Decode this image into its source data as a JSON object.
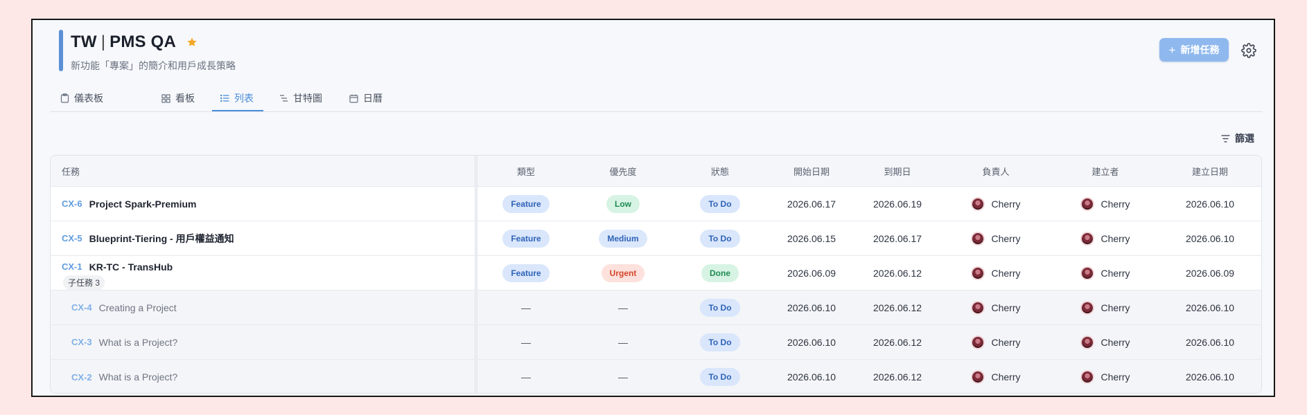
{
  "header": {
    "title_left": "TW",
    "title_sep": "|",
    "title_right": "PMS QA",
    "subtitle": "新功能「專案」的簡介和用戶成長策略",
    "new_task_label": "新增任務",
    "accent_color": "#5b8fd6",
    "star_color": "#f5a623"
  },
  "tabs": [
    {
      "label": "儀表板",
      "icon": "clipboard-icon"
    },
    {
      "label": "看板",
      "icon": "grid-icon"
    },
    {
      "label": "列表",
      "icon": "list-icon",
      "active": true
    },
    {
      "label": "甘特圖",
      "icon": "gantt-icon"
    },
    {
      "label": "日曆",
      "icon": "calendar-icon"
    }
  ],
  "filter_label": "篩選",
  "table": {
    "columns": [
      "任務",
      "類型",
      "優先度",
      "狀態",
      "開始日期",
      "到期日",
      "負責人",
      "建立者",
      "建立日期"
    ],
    "rows": [
      {
        "id": "CX-6",
        "name": "Project Spark-Premium",
        "type": "Feature",
        "priority": "Low",
        "status": "To Do",
        "start": "2026.06.17",
        "due": "2026.06.19",
        "assignee": "Cherry",
        "creator": "Cherry",
        "created": "2026.06.10"
      },
      {
        "id": "CX-5",
        "name": "Blueprint-Tiering - 用戶權益通知",
        "type": "Feature",
        "priority": "Medium",
        "status": "To Do",
        "start": "2026.06.15",
        "due": "2026.06.17",
        "assignee": "Cherry",
        "creator": "Cherry",
        "created": "2026.06.10"
      },
      {
        "id": "CX-1",
        "name": "KR-TC - TransHub",
        "subtasks": "子任務 3",
        "type": "Feature",
        "priority": "Urgent",
        "status": "Done",
        "start": "2026.06.09",
        "due": "2026.06.12",
        "assignee": "Cherry",
        "creator": "Cherry",
        "created": "2026.06.09"
      },
      {
        "id": "CX-4",
        "name": "Creating a Project",
        "type": "—",
        "priority": "—",
        "status": "To Do",
        "start": "2026.06.10",
        "due": "2026.06.12",
        "assignee": "Cherry",
        "creator": "Cherry",
        "created": "2026.06.10"
      },
      {
        "id": "CX-3",
        "name": "What is a Project?",
        "type": "—",
        "priority": "—",
        "status": "To Do",
        "start": "2026.06.10",
        "due": "2026.06.12",
        "assignee": "Cherry",
        "creator": "Cherry",
        "created": "2026.06.10"
      },
      {
        "id": "CX-2",
        "name": "What is a Project?",
        "type": "—",
        "priority": "—",
        "status": "To Do",
        "start": "2026.06.10",
        "due": "2026.06.12",
        "assignee": "Cherry",
        "creator": "Cherry",
        "created": "2026.06.10"
      }
    ]
  }
}
